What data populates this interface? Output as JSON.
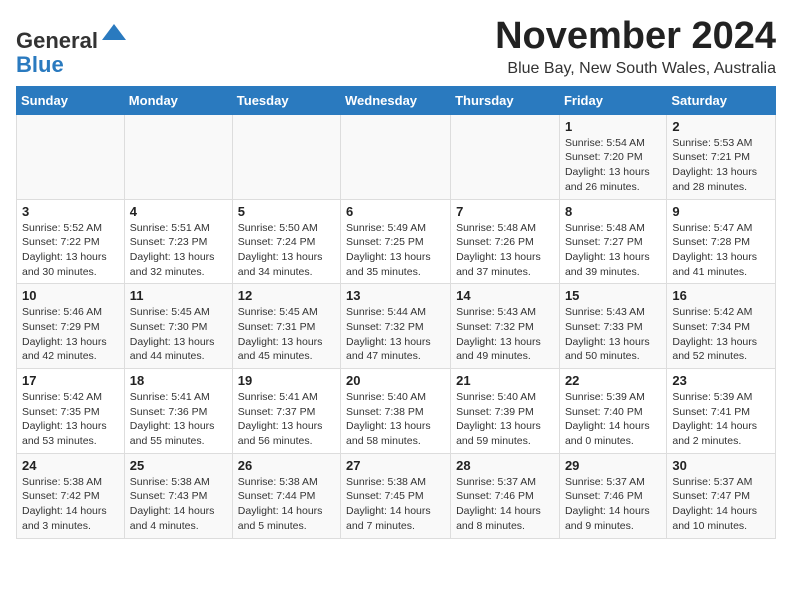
{
  "header": {
    "logo_general": "General",
    "logo_blue": "Blue",
    "month_title": "November 2024",
    "location": "Blue Bay, New South Wales, Australia"
  },
  "weekdays": [
    "Sunday",
    "Monday",
    "Tuesday",
    "Wednesday",
    "Thursday",
    "Friday",
    "Saturday"
  ],
  "weeks": [
    [
      {
        "day": "",
        "info": ""
      },
      {
        "day": "",
        "info": ""
      },
      {
        "day": "",
        "info": ""
      },
      {
        "day": "",
        "info": ""
      },
      {
        "day": "",
        "info": ""
      },
      {
        "day": "1",
        "info": "Sunrise: 5:54 AM\nSunset: 7:20 PM\nDaylight: 13 hours and 26 minutes."
      },
      {
        "day": "2",
        "info": "Sunrise: 5:53 AM\nSunset: 7:21 PM\nDaylight: 13 hours and 28 minutes."
      }
    ],
    [
      {
        "day": "3",
        "info": "Sunrise: 5:52 AM\nSunset: 7:22 PM\nDaylight: 13 hours and 30 minutes."
      },
      {
        "day": "4",
        "info": "Sunrise: 5:51 AM\nSunset: 7:23 PM\nDaylight: 13 hours and 32 minutes."
      },
      {
        "day": "5",
        "info": "Sunrise: 5:50 AM\nSunset: 7:24 PM\nDaylight: 13 hours and 34 minutes."
      },
      {
        "day": "6",
        "info": "Sunrise: 5:49 AM\nSunset: 7:25 PM\nDaylight: 13 hours and 35 minutes."
      },
      {
        "day": "7",
        "info": "Sunrise: 5:48 AM\nSunset: 7:26 PM\nDaylight: 13 hours and 37 minutes."
      },
      {
        "day": "8",
        "info": "Sunrise: 5:48 AM\nSunset: 7:27 PM\nDaylight: 13 hours and 39 minutes."
      },
      {
        "day": "9",
        "info": "Sunrise: 5:47 AM\nSunset: 7:28 PM\nDaylight: 13 hours and 41 minutes."
      }
    ],
    [
      {
        "day": "10",
        "info": "Sunrise: 5:46 AM\nSunset: 7:29 PM\nDaylight: 13 hours and 42 minutes."
      },
      {
        "day": "11",
        "info": "Sunrise: 5:45 AM\nSunset: 7:30 PM\nDaylight: 13 hours and 44 minutes."
      },
      {
        "day": "12",
        "info": "Sunrise: 5:45 AM\nSunset: 7:31 PM\nDaylight: 13 hours and 45 minutes."
      },
      {
        "day": "13",
        "info": "Sunrise: 5:44 AM\nSunset: 7:32 PM\nDaylight: 13 hours and 47 minutes."
      },
      {
        "day": "14",
        "info": "Sunrise: 5:43 AM\nSunset: 7:32 PM\nDaylight: 13 hours and 49 minutes."
      },
      {
        "day": "15",
        "info": "Sunrise: 5:43 AM\nSunset: 7:33 PM\nDaylight: 13 hours and 50 minutes."
      },
      {
        "day": "16",
        "info": "Sunrise: 5:42 AM\nSunset: 7:34 PM\nDaylight: 13 hours and 52 minutes."
      }
    ],
    [
      {
        "day": "17",
        "info": "Sunrise: 5:42 AM\nSunset: 7:35 PM\nDaylight: 13 hours and 53 minutes."
      },
      {
        "day": "18",
        "info": "Sunrise: 5:41 AM\nSunset: 7:36 PM\nDaylight: 13 hours and 55 minutes."
      },
      {
        "day": "19",
        "info": "Sunrise: 5:41 AM\nSunset: 7:37 PM\nDaylight: 13 hours and 56 minutes."
      },
      {
        "day": "20",
        "info": "Sunrise: 5:40 AM\nSunset: 7:38 PM\nDaylight: 13 hours and 58 minutes."
      },
      {
        "day": "21",
        "info": "Sunrise: 5:40 AM\nSunset: 7:39 PM\nDaylight: 13 hours and 59 minutes."
      },
      {
        "day": "22",
        "info": "Sunrise: 5:39 AM\nSunset: 7:40 PM\nDaylight: 14 hours and 0 minutes."
      },
      {
        "day": "23",
        "info": "Sunrise: 5:39 AM\nSunset: 7:41 PM\nDaylight: 14 hours and 2 minutes."
      }
    ],
    [
      {
        "day": "24",
        "info": "Sunrise: 5:38 AM\nSunset: 7:42 PM\nDaylight: 14 hours and 3 minutes."
      },
      {
        "day": "25",
        "info": "Sunrise: 5:38 AM\nSunset: 7:43 PM\nDaylight: 14 hours and 4 minutes."
      },
      {
        "day": "26",
        "info": "Sunrise: 5:38 AM\nSunset: 7:44 PM\nDaylight: 14 hours and 5 minutes."
      },
      {
        "day": "27",
        "info": "Sunrise: 5:38 AM\nSunset: 7:45 PM\nDaylight: 14 hours and 7 minutes."
      },
      {
        "day": "28",
        "info": "Sunrise: 5:37 AM\nSunset: 7:46 PM\nDaylight: 14 hours and 8 minutes."
      },
      {
        "day": "29",
        "info": "Sunrise: 5:37 AM\nSunset: 7:46 PM\nDaylight: 14 hours and 9 minutes."
      },
      {
        "day": "30",
        "info": "Sunrise: 5:37 AM\nSunset: 7:47 PM\nDaylight: 14 hours and 10 minutes."
      }
    ]
  ]
}
